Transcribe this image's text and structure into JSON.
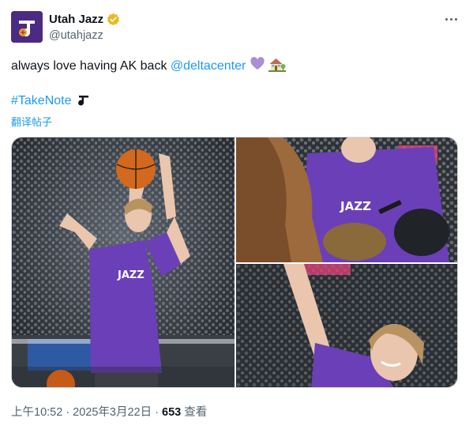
{
  "account": {
    "display_name": "Utah Jazz",
    "handle": "@utahjazz",
    "avatar_icon": "jazz-note-logo",
    "verified_icon": "gold-verified-badge",
    "brand_color": "#4b2a82"
  },
  "tweet": {
    "text_before_mention": "always love having AK back ",
    "mention": "@deltacenter",
    "emojis_line1": "purple-heart house-with-garden",
    "hashtag": "#TakeNote",
    "hashtag_emoji": "jazz-note-logo",
    "translate_label": "翻译帖子"
  },
  "media": {
    "photos": [
      {
        "name": "player-shooting-basketball",
        "jersey_text": "JAZZ"
      },
      {
        "name": "player-signing-autograph",
        "jersey_text": "JAZZ"
      },
      {
        "name": "player-reaching-crowd"
      }
    ]
  },
  "meta": {
    "timestamp": "上午10:52 · 2025年3月22日 · ",
    "views_count": "653",
    "views_label": " 查看"
  },
  "colors": {
    "link": "#1d9bf0",
    "text": "#0f1419",
    "secondary": "#536471",
    "jersey_purple": "#6b3fb8"
  }
}
